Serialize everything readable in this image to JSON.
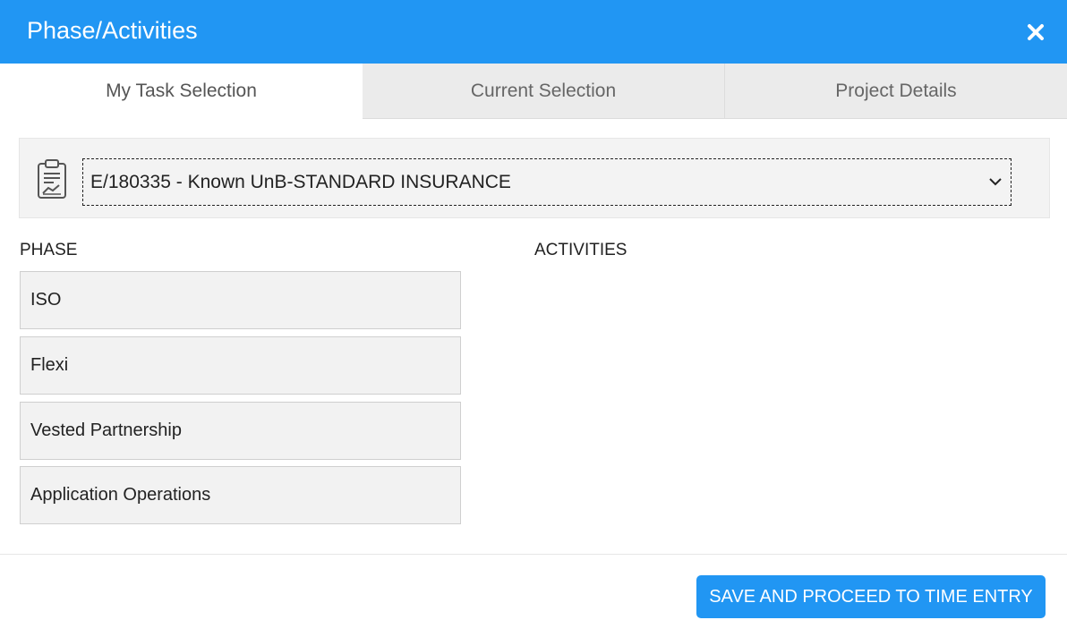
{
  "dialog": {
    "title": "Phase/Activities",
    "close_icon": "close-icon"
  },
  "tabs": [
    {
      "label": "My Task Selection",
      "active": true
    },
    {
      "label": "Current Selection",
      "active": false
    },
    {
      "label": "Project Details",
      "active": false
    }
  ],
  "project": {
    "icon": "clipboard-chart-icon",
    "selected": "E/180335 - Known UnB-STANDARD INSURANCE"
  },
  "phase": {
    "label": "PHASE",
    "items": [
      {
        "label": "ISO"
      },
      {
        "label": "Flexi"
      },
      {
        "label": "Vested Partnership"
      },
      {
        "label": "Application Operations"
      }
    ]
  },
  "activities": {
    "label": "ACTIVITIES",
    "items": []
  },
  "footer": {
    "save_label": "SAVE AND PROCEED TO TIME ENTRY"
  },
  "colors": {
    "header": "#2196f3",
    "button": "#2196f3",
    "tab_inactive": "#ebebeb",
    "item_bg": "#f2f2f2"
  }
}
